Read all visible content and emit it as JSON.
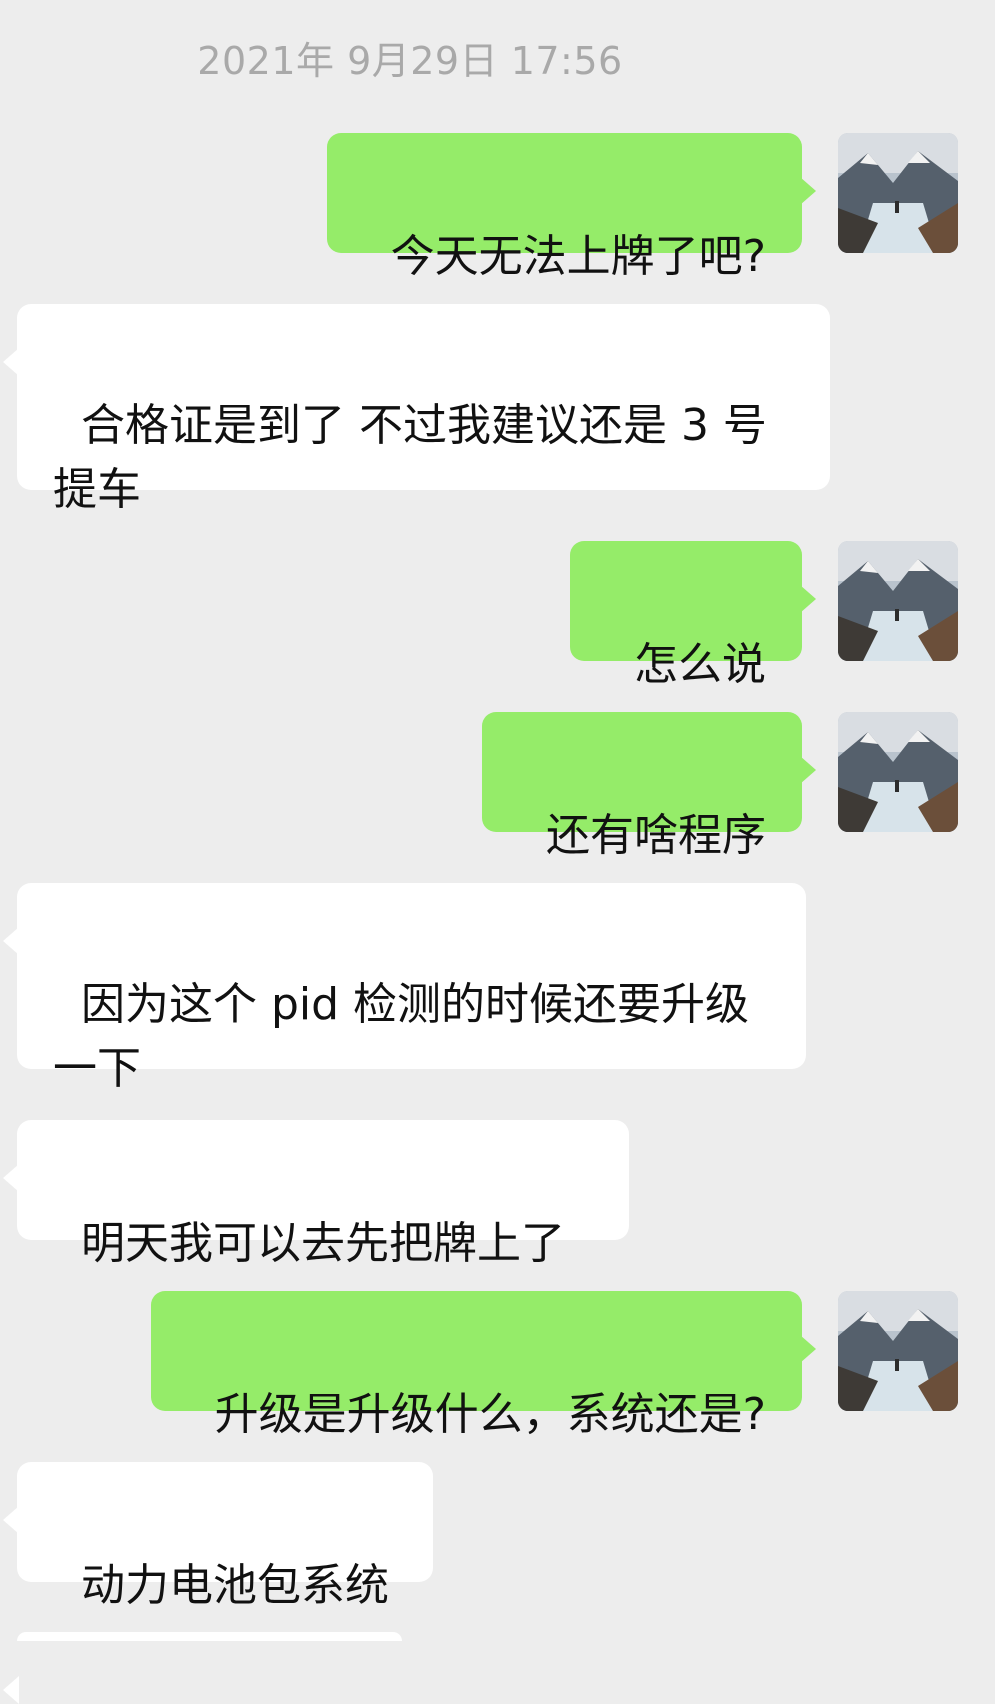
{
  "timestamp": "2021年 9月29日 17:56",
  "messages": [
    {
      "side": "sent",
      "text": "今天无法上牌了吧?"
    },
    {
      "side": "received",
      "text": "合格证是到了 不过我建议还是 3 号\n提车"
    },
    {
      "side": "sent",
      "text": "怎么说"
    },
    {
      "side": "sent",
      "text": "还有啥程序"
    },
    {
      "side": "received",
      "text": "因为这个 pid 检测的时候还要升级\n一下"
    },
    {
      "side": "received",
      "text": "明天我可以去先把牌上了"
    },
    {
      "side": "sent",
      "text": "升级是升级什么，系统还是?"
    },
    {
      "side": "received",
      "text": "动力电池包系统"
    }
  ],
  "avatar_icon": "mountain-lake-avatar-icon",
  "colors": {
    "background": "#ededed",
    "sent_bubble": "#95ec69",
    "received_bubble": "#ffffff",
    "timestamp_text": "#a9a9a9"
  }
}
